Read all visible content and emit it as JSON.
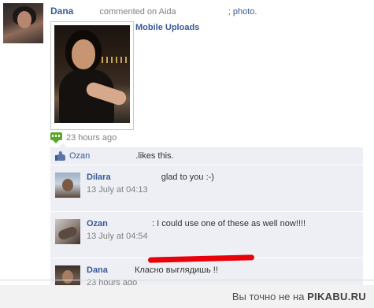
{
  "story": {
    "author": "Dana",
    "verb": "commented on Aida",
    "suffix": "; photo.",
    "album": "Mobile Uploads",
    "time": "23 hours ago"
  },
  "likes": {
    "liker": "Ozan",
    "text": ".likes this."
  },
  "comments": [
    {
      "name": "Dilara",
      "text": "glad to you :-)",
      "time": "13 July at 04:13"
    },
    {
      "name": "Ozan",
      "text": ": I could use one of these as well now!!!!",
      "time": "13 July at 04:54"
    },
    {
      "name": "Dana",
      "text": "Класно выглядишь !!",
      "time": "23 hours ago"
    }
  ],
  "footer": {
    "prefix": "Вы точно не на",
    "brand": "PIKABU.RU"
  },
  "colors": {
    "link": "#3b5998",
    "feedback_bg": "#edeff4",
    "timestamp": "#808080",
    "highlight": "#e8000b",
    "mobile_icon": "#5ba72d"
  },
  "icons": [
    "mobile-upload-icon",
    "like-thumb-icon"
  ]
}
